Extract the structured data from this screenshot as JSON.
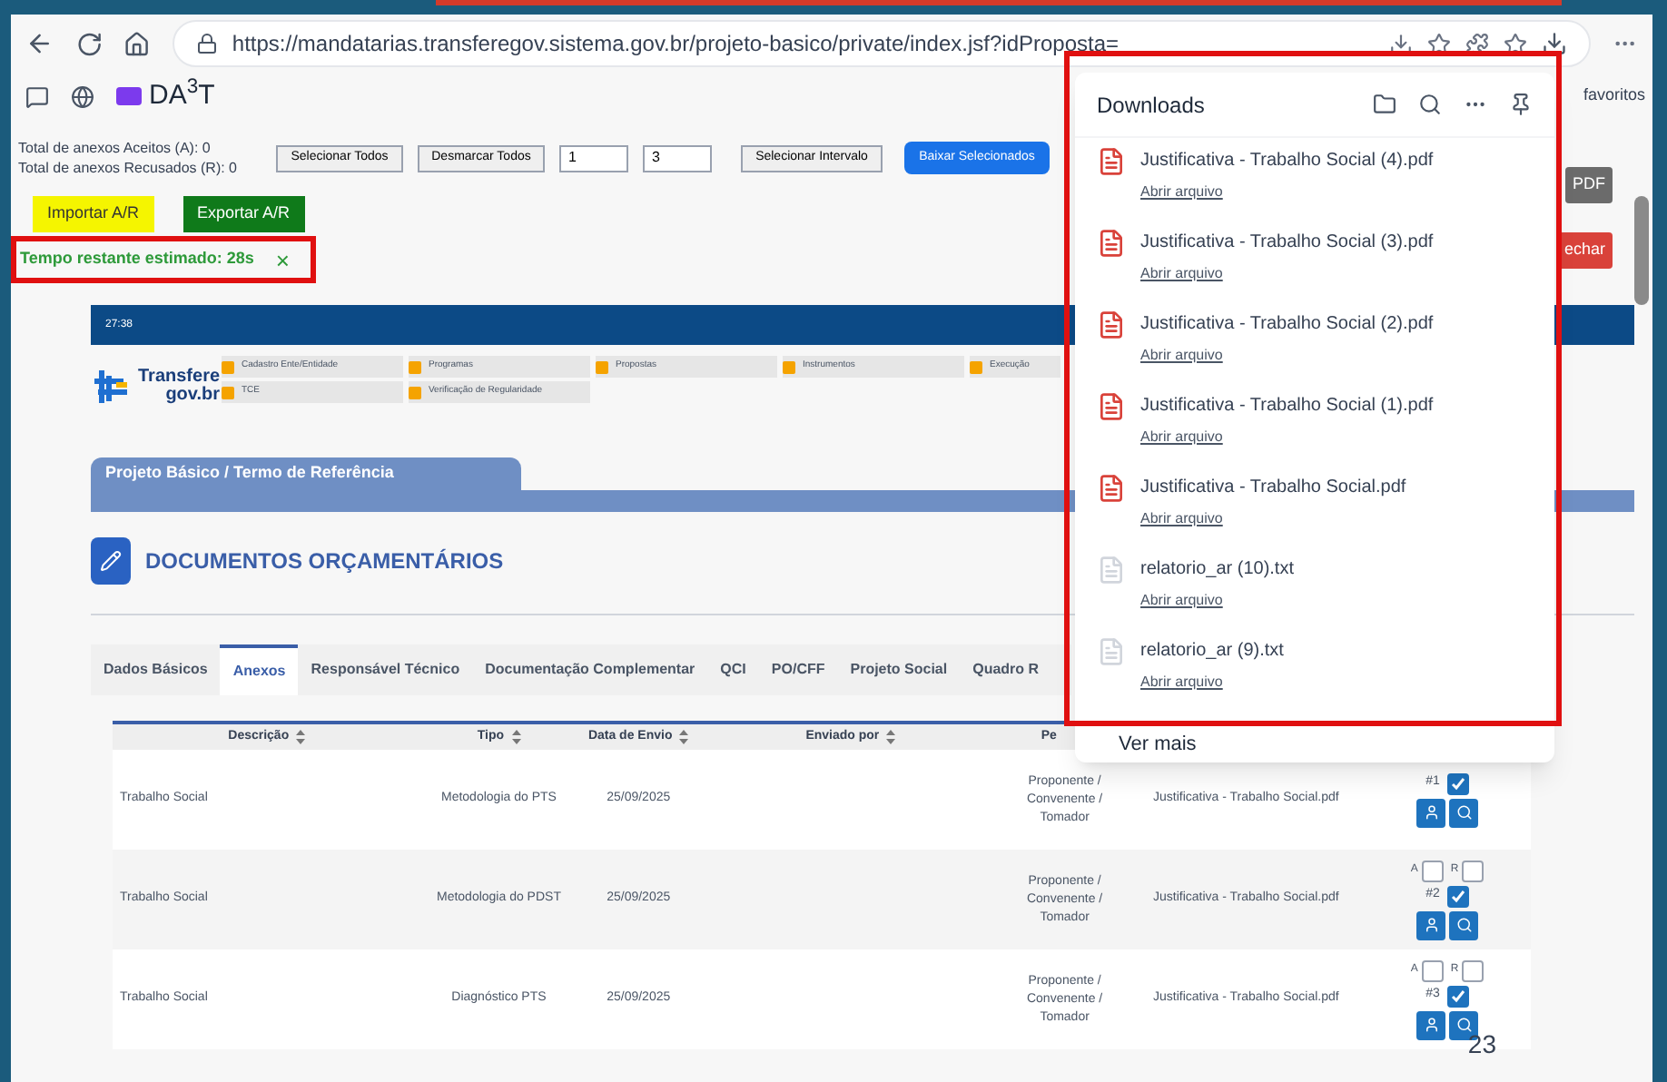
{
  "browser": {
    "url": "https://mandatarias.transferegov.sistema.gov.br/projeto-basico/private/index.jsf?idProposta=",
    "bookmark": "DA$^{3}$T",
    "favorites": "favoritos"
  },
  "totals": [
    "Total de anexos Aceitos (A): 0",
    "Total de anexos Recusados (R): 0"
  ],
  "selection": {
    "buttons": [
      "Selecionar Todos",
      "Desmarcar Todos"
    ],
    "from": "1",
    "to": "3",
    "range_button": "Selecionar Intervalo",
    "download_button": "Baixar Selecionados"
  },
  "right_buttons": [
    {
      "label": "PDF",
      "kind": "grey"
    },
    {
      "label": "echar",
      "kind": "red"
    }
  ],
  "ar_buttons": [
    {
      "label": "Importar A/R",
      "kind": "yellow"
    },
    {
      "label": "Exportar A/R",
      "kind": "green"
    }
  ],
  "timer": {
    "text": "Tempo restante estimado: 28s",
    "close": "×"
  },
  "portal": {
    "clock": "27:38",
    "logo": [
      "Transfere",
      "gov.br"
    ],
    "menu": [
      "Cadastro Ente/Entidade",
      "Programas",
      "Propostas",
      "Instrumentos",
      "Execução",
      "TCE",
      "Verificação de Regularidade"
    ],
    "section_tab": "Projeto Básico / Termo de Referência",
    "heading": "DOCUMENTOS ORÇAMENTÁRIOS"
  },
  "tabs": [
    {
      "label": "Dados Básicos",
      "selected": false
    },
    {
      "label": "Anexos",
      "selected": true
    },
    {
      "label": "Responsável Técnico",
      "selected": false
    },
    {
      "label": "Documentação Complementar",
      "selected": false
    },
    {
      "label": "QCI",
      "selected": false
    },
    {
      "label": "PO/CFF",
      "selected": false
    },
    {
      "label": "Projeto Social",
      "selected": false
    },
    {
      "label": "Quadro R",
      "selected": false
    }
  ],
  "table": {
    "columns": [
      "Descrição",
      "Tipo",
      "Data de Envio",
      "Enviado por",
      "Pe"
    ],
    "rows": [
      {
        "description": "Trabalho Social",
        "type": "Metodologia do PTS",
        "date": "25/09/2025",
        "profile": "Proponente / Convenente / Tomador",
        "file": "Justificativa - Trabalho Social.pdf",
        "number": "#1",
        "checked": true
      },
      {
        "description": "Trabalho Social",
        "type": "Metodologia do PDST",
        "date": "25/09/2025",
        "profile": "Proponente / Convenente / Tomador",
        "file": "Justificativa - Trabalho Social.pdf",
        "number": "#2",
        "checked": true,
        "review": [
          {
            "label": "A",
            "checked": false
          },
          {
            "label": "R",
            "checked": false
          }
        ]
      },
      {
        "description": "Trabalho Social",
        "type": "Diagnóstico PTS",
        "date": "25/09/2025",
        "profile": "Proponente / Convenente / Tomador",
        "file": "Justificativa - Trabalho Social.pdf",
        "number": "#3",
        "checked": true,
        "review": [
          {
            "label": "A",
            "checked": false
          },
          {
            "label": "R",
            "checked": false
          }
        ]
      }
    ]
  },
  "downloads": {
    "title": "Downloads",
    "items": [
      {
        "name": "Justificativa - Trabalho Social (4).pdf",
        "kind": "pdf",
        "action": "Abrir arquivo"
      },
      {
        "name": "Justificativa - Trabalho Social (3).pdf",
        "kind": "pdf",
        "action": "Abrir arquivo"
      },
      {
        "name": "Justificativa - Trabalho Social (2).pdf",
        "kind": "pdf",
        "action": "Abrir arquivo"
      },
      {
        "name": "Justificativa - Trabalho Social (1).pdf",
        "kind": "pdf",
        "action": "Abrir arquivo"
      },
      {
        "name": "Justificativa - Trabalho Social.pdf",
        "kind": "pdf",
        "action": "Abrir arquivo"
      },
      {
        "name": "relatorio_ar (10).txt",
        "kind": "txt",
        "action": "Abrir arquivo"
      },
      {
        "name": "relatorio_ar (9).txt",
        "kind": "txt",
        "action": "Abrir arquivo"
      }
    ],
    "more": "Ver mais"
  },
  "slide_number": "23"
}
